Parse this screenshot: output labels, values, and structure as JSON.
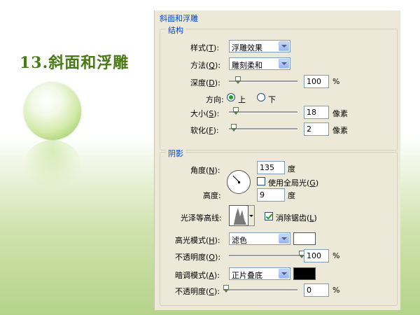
{
  "slide": {
    "title": "13.斜面和浮雕"
  },
  "dialog": {
    "title": "斜面和浮雕",
    "structure": {
      "legend": "结构",
      "style": {
        "label": "样式(T):",
        "value": "浮雕效果"
      },
      "technique": {
        "label": "方法(Q):",
        "value": "雕刻柔和"
      },
      "depth": {
        "label": "深度(D):",
        "value": "100",
        "unit": "%",
        "slider_fraction": 0.1
      },
      "direction": {
        "label": "方向:",
        "up": "上",
        "down": "下",
        "selected": "上"
      },
      "size": {
        "label": "大小(S):",
        "value": "18",
        "unit": "像素",
        "slider_fraction": 0.07
      },
      "soften": {
        "label": "软化(F):",
        "value": "2",
        "unit": "像素",
        "slider_fraction": 0.03
      }
    },
    "shading": {
      "legend": "阴影",
      "angle": {
        "label": "角度(N):",
        "value": "135",
        "unit": "度"
      },
      "global_light": {
        "label": "使用全局光(G)",
        "checked": false
      },
      "altitude": {
        "label": "高度:",
        "value": "9",
        "unit": "度"
      },
      "gloss_contour": {
        "label": "光泽等高线:"
      },
      "anti_aliased": {
        "label": "消除锯齿(L)",
        "checked": true
      },
      "highlight_mode": {
        "label": "高光模式(H):",
        "value": "滤色",
        "color": "#ffffff"
      },
      "highlight_opacity": {
        "label": "不透明度(O):",
        "value": "100",
        "unit": "%",
        "slider_fraction": 1.0
      },
      "shadow_mode": {
        "label": "暗调模式(A):",
        "value": "正片叠底",
        "color": "#000000"
      },
      "shadow_opacity": {
        "label": "不透明度(C):",
        "value": "0",
        "unit": "%",
        "slider_fraction": 0.0
      }
    }
  },
  "colors": {
    "title_green": "#4a7a17",
    "dialog_bg": "#ece9d8",
    "legend_blue": "#0046d5"
  }
}
